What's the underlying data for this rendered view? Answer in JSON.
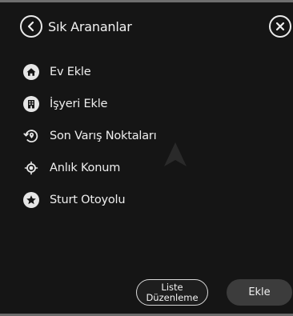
{
  "header": {
    "title": "Sık Arananlar"
  },
  "items": [
    {
      "label": "Ev Ekle",
      "icon": "home-icon"
    },
    {
      "label": "İşyeri Ekle",
      "icon": "building-icon"
    },
    {
      "label": "Son Varış Noktaları",
      "icon": "history-location-icon"
    },
    {
      "label": "Anlık Konum",
      "icon": "current-location-icon"
    },
    {
      "label": "Sturt Otoyolu",
      "icon": "star-icon"
    }
  ],
  "footer": {
    "liste_line1": "Liste",
    "liste_line2": "Düzenleme",
    "ekle_label": "Ekle"
  },
  "colors": {
    "background": "#151515",
    "icon_fill": "#e6e6e6",
    "secondary_button": "#3c3c3c"
  }
}
